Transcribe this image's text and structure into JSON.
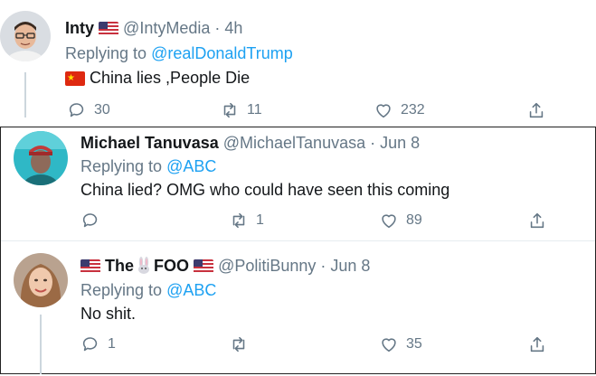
{
  "tweets": [
    {
      "name": "Inty",
      "handle": "@IntyMedia",
      "time": "· 4h",
      "replying_prefix": "Replying to",
      "replying_to": "@realDonaldTrump",
      "text": "China lies ,People Die",
      "replies": "30",
      "retweets": "11",
      "likes": "232",
      "name_flag": "us-flag",
      "text_flag": "china-flag"
    },
    {
      "name": "Michael Tanuvasa",
      "handle": "@MichaelTanuvasa",
      "time": "· Jun 8",
      "replying_prefix": "Replying to",
      "replying_to": "@ABC",
      "text": "China lied? OMG who could have seen this coming",
      "replies": "",
      "retweets": "1",
      "likes": "89"
    },
    {
      "name_left": "The",
      "name_right": "FOO",
      "handle": "@PolitiBunny",
      "time": "· Jun 8",
      "replying_prefix": "Replying to",
      "replying_to": "@ABC",
      "text": "No shit.",
      "replies": "1",
      "retweets": "",
      "likes": "35",
      "name_icons": [
        "us-flag",
        "rabbit-icon",
        "us-flag"
      ]
    }
  ],
  "colors": {
    "link": "#1da1f2",
    "secondary_text": "#657786",
    "primary_text": "#14171a",
    "divider": "#e6ecf0",
    "thread_line": "#ccd6dd"
  },
  "icons": {
    "reply": "reply-icon",
    "retweet": "retweet-icon",
    "like": "heart-icon",
    "share": "share-icon"
  }
}
